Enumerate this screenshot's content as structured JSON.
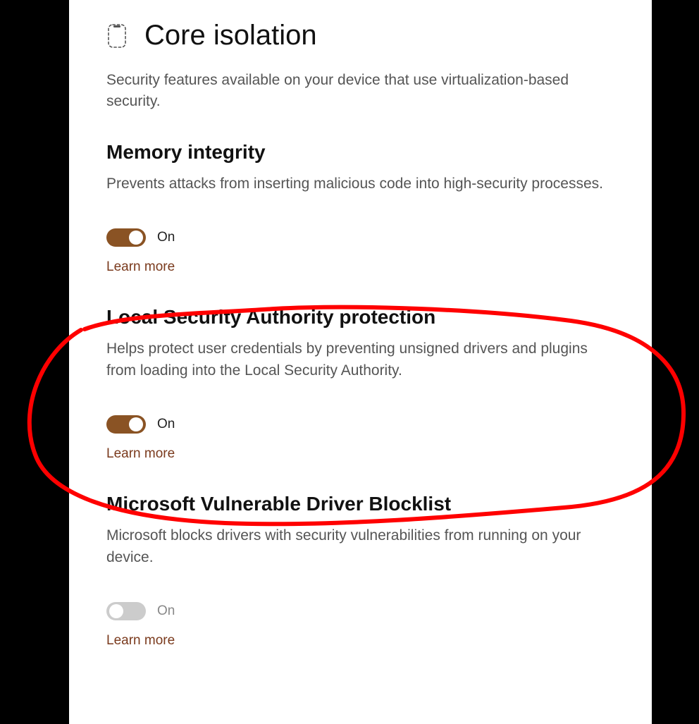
{
  "page": {
    "title": "Core isolation",
    "subtitle": "Security features available on your device that use virtualization-based security."
  },
  "sections": [
    {
      "title": "Memory integrity",
      "desc": "Prevents attacks from inserting malicious code into high-security processes.",
      "toggle_state": "On",
      "toggle_enabled": true,
      "learn": "Learn more"
    },
    {
      "title": "Local Security Authority protection",
      "desc": "Helps protect user credentials by preventing unsigned drivers and plugins from loading into the Local Security Authority.",
      "toggle_state": "On",
      "toggle_enabled": true,
      "learn": "Learn more"
    },
    {
      "title": "Microsoft Vulnerable Driver Blocklist",
      "desc": "Microsoft blocks drivers with security vulnerabilities from running on your device.",
      "toggle_state": "On",
      "toggle_enabled": false,
      "learn": "Learn more"
    }
  ],
  "annotation": {
    "type": "hand-drawn-circle",
    "color": "#ff0000",
    "target_section_index": 1
  }
}
